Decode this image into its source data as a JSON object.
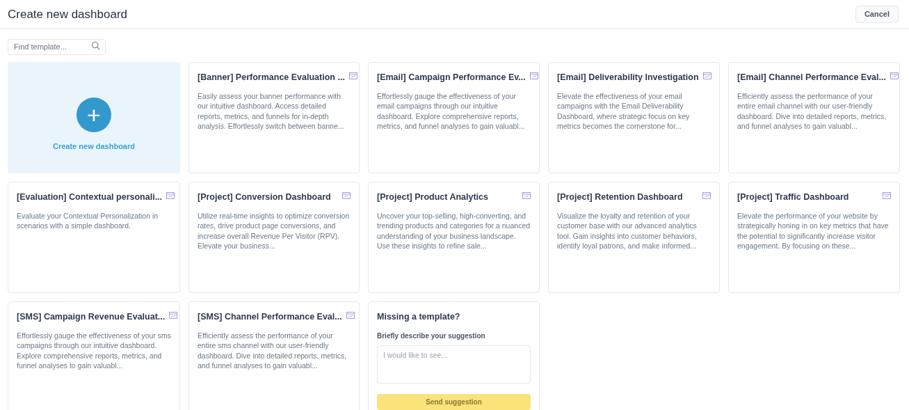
{
  "header": {
    "title": "Create new dashboard",
    "cancel_button": "Cancel"
  },
  "search": {
    "placeholder": "Find template..."
  },
  "create_card": {
    "label": "Create new dashboard",
    "icon": "+"
  },
  "templates": [
    {
      "title": "[Banner] Performance Evaluation ...",
      "description": "Easily assess your banner performance with our intuitive dashboard. Access detailed reports, metrics, and funnels for in-depth analysis. Effortlessly switch between banne..."
    },
    {
      "title": "[Email] Campaign Performance Ev...",
      "description": "Effortlessly gauge the effectiveness of your email campaigns through our intuitive dashboard. Explore comprehensive reports, metrics, and funnel analyses to gain valuabl..."
    },
    {
      "title": "[Email] Deliverability Investigation",
      "description": "Elevate the effectiveness of your email campaigns with the Email Deliverability Dashboard, where strategic focus on key metrics becomes the cornerstone for..."
    },
    {
      "title": "[Email] Channel Performance Eval...",
      "description": "Efficiently assess the performance of your entire email channel with our user-friendly dashboard. Dive into detailed reports, metrics, and funnel analyses to gain valuabl..."
    },
    {
      "title": "[Evaluation] Contextual personali...",
      "description": "Evaluate your Contextual Personalization in scenarios with a simple dashboard."
    },
    {
      "title": "[Project] Conversion Dashboard",
      "description": "Utilize real-time insights to optimize conversion rates, drive product page conversions, and increase overall Revenue Per Visitor (RPV). Elevate your business..."
    },
    {
      "title": "[Project] Product Analytics",
      "description": "Uncover your top-selling, high-converting, and trending products and categories for a nuanced understanding of your business landscape. Use these insights to refine sale..."
    },
    {
      "title": "[Project] Retention Dashboard",
      "description": "Visualize the loyalty and retention of your customer base with our advanced analytics tool. Gain insights into customer behaviors, identify loyal patrons, and make informed..."
    },
    {
      "title": "[Project] Traffic Dashboard",
      "description": "Elevate the performance of your website by strategically honing in on key metrics that have the potential to significantly increase visitor engagement. By focusing on these..."
    },
    {
      "title": "[SMS] Campaign Revenue Evaluat...",
      "description": "Effortlessly gauge the effectiveness of your sms campaigns through our intuitive dashboard. Explore comprehensive reports, metrics, and funnel analyses to gain valuabl..."
    },
    {
      "title": "[SMS] Channel Performance Eval...",
      "description": "Efficiently assess the performance of your entire sms channel with our user-friendly dashboard. Dive into detailed reports, metrics, and funnel analyses to gain valuabl..."
    }
  ],
  "suggestion_card": {
    "title": "Missing a template?",
    "label": "Briefly describe your suggestion",
    "placeholder": "I would like to see...",
    "button": {
      "label": "Send suggestion",
      "disabled": true
    }
  }
}
